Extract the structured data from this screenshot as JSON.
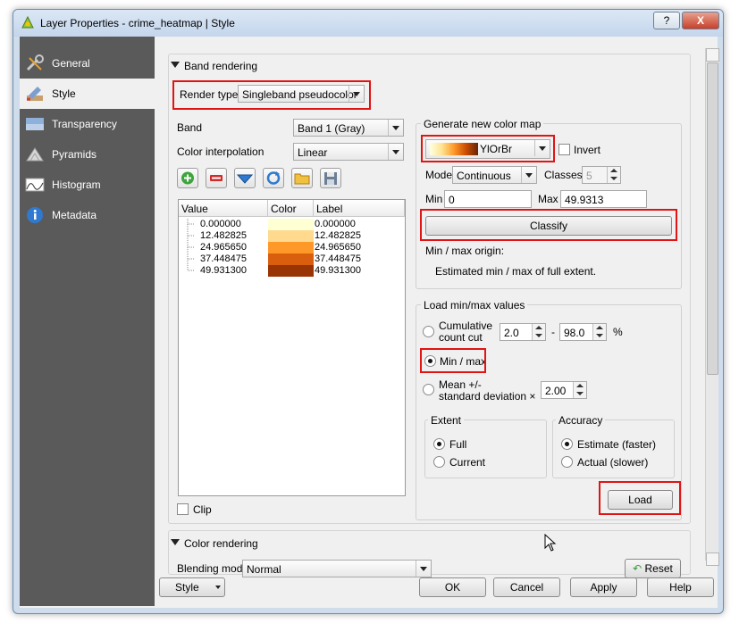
{
  "window": {
    "title": "Layer Properties - crime_heatmap | Style",
    "help_btn": "?",
    "close_btn": "X"
  },
  "sidebar": {
    "items": [
      {
        "label": "General",
        "icon": "wrench-icon"
      },
      {
        "label": "Style",
        "icon": "brush-icon"
      },
      {
        "label": "Transparency",
        "icon": "transparency-icon"
      },
      {
        "label": "Pyramids",
        "icon": "pyramids-icon"
      },
      {
        "label": "Histogram",
        "icon": "histogram-icon"
      },
      {
        "label": "Metadata",
        "icon": "info-icon"
      }
    ],
    "selected": "Style"
  },
  "band_rendering": {
    "title": "Band rendering",
    "render_type_label": "Render type",
    "render_type_value": "Singleband pseudocolor",
    "band_label": "Band",
    "band_value": "Band 1 (Gray)",
    "interp_label": "Color interpolation",
    "interp_value": "Linear",
    "table": {
      "headers": [
        "Value",
        "Color",
        "Label"
      ],
      "rows": [
        {
          "value": "0.000000",
          "color": "#ffffd4",
          "label": "0.000000"
        },
        {
          "value": "12.482825",
          "color": "#fed98e",
          "label": "12.482825"
        },
        {
          "value": "24.965650",
          "color": "#fe9929",
          "label": "24.965650"
        },
        {
          "value": "37.448475",
          "color": "#d95f0e",
          "label": "37.448475"
        },
        {
          "value": "49.931300",
          "color": "#993404",
          "label": "49.931300"
        }
      ]
    },
    "clip_label": "Clip"
  },
  "generate": {
    "title": "Generate new color map",
    "ramp": "YlOrBr",
    "invert_label": "Invert",
    "mode_label": "Mode",
    "mode_value": "Continuous",
    "classes_label": "Classes",
    "classes_value": "5",
    "min_label": "Min",
    "min_value": "0",
    "max_label": "Max",
    "max_value": "49.9313",
    "classify_btn": "Classify",
    "origin_label": "Min / max origin:",
    "origin_value": "Estimated min / max of full extent."
  },
  "load_minmax": {
    "title": "Load min/max values",
    "cumulative_label": "Cumulative count cut",
    "cumulative_low": "2.0",
    "dash": "-",
    "cumulative_high": "98.0",
    "percent": "%",
    "minmax_label": "Min / max",
    "mean_label_1": "Mean +/-",
    "mean_label_2": "standard deviation ×",
    "stddev_value": "2.00",
    "extent_title": "Extent",
    "extent_full": "Full",
    "extent_current": "Current",
    "accuracy_title": "Accuracy",
    "accuracy_estimate": "Estimate (faster)",
    "accuracy_actual": "Actual (slower)",
    "load_btn": "Load"
  },
  "color_rendering": {
    "title": "Color rendering",
    "blending_label": "Blending mode",
    "blending_value": "Normal",
    "reset_btn": "Reset"
  },
  "footer": {
    "style_btn": "Style",
    "ok_btn": "OK",
    "cancel_btn": "Cancel",
    "apply_btn": "Apply",
    "help_btn": "Help"
  }
}
